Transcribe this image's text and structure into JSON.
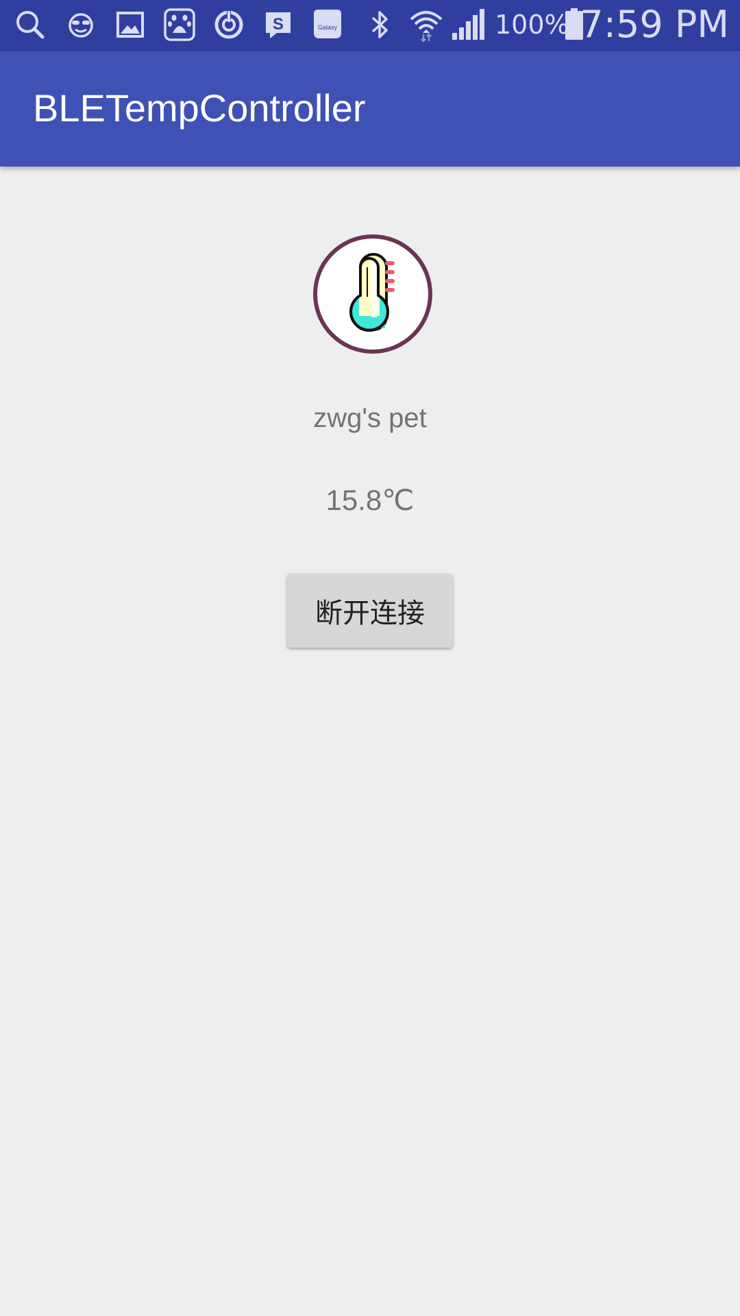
{
  "status_bar": {
    "icons": [
      "search-icon",
      "face-icon",
      "gallery-icon",
      "baidu-icon",
      "sync-icon",
      "s-app-icon",
      "galaxy-icon",
      "bluetooth-icon",
      "wifi-icon",
      "signal-icon",
      "battery-icon"
    ],
    "galaxy_label": "Galaxy",
    "battery_percent": "100%",
    "time": "7:59 PM"
  },
  "app_bar": {
    "title": "BLETempController"
  },
  "main": {
    "icon": "thermometer-icon",
    "device_name": "zwg's pet",
    "temperature": "15.8℃",
    "disconnect_button_label": "断开连接"
  },
  "colors": {
    "status_bar": "#303f9f",
    "app_bar": "#3f51b5",
    "background": "#eeeeee",
    "button": "#d6d7d7",
    "thermometer_ring": "#6a3552",
    "thermometer_liquid": "#41e6dd",
    "thermometer_tube": "#fffcc6",
    "thermometer_marks": "#e8606f"
  }
}
